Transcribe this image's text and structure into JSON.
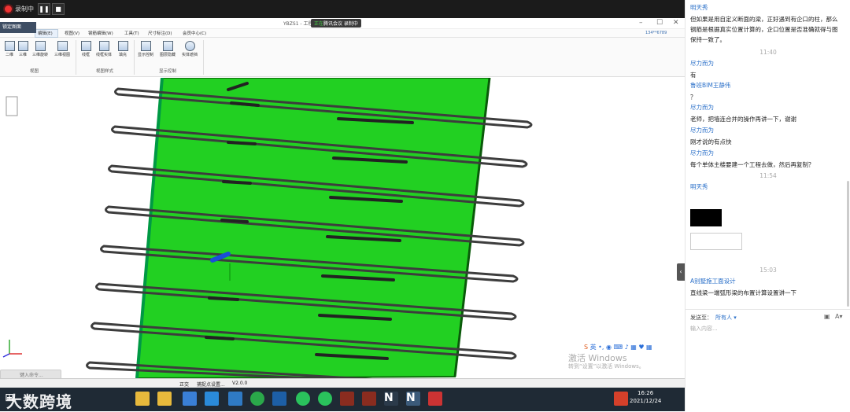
{
  "recording": {
    "label": "录制中"
  },
  "app": {
    "title": "YBZS1 - 工程",
    "notice": {
      "green": "正在",
      "text": "腾讯会议 录制中"
    },
    "lock_label": "锁定图面",
    "account": "134**6789",
    "menus": [
      "编辑(E)",
      "视图(V)",
      "钢筋编辑(W)",
      "工具(T)",
      "尺寸标注(D)",
      "会员中心(C)"
    ],
    "ribbon": {
      "buttons": [
        "二维",
        "三维",
        "三维旋转",
        "三维视图",
        "线框",
        "线框实体",
        "填充",
        "显示控制",
        "图层隐藏",
        "实体遮挡"
      ],
      "groups": [
        "视图",
        "视图样式",
        "显示控制"
      ]
    },
    "command_placeholder": "键入命令...",
    "status": {
      "mode": "正交",
      "capture": "捕捉点设置...",
      "version": "V2.0.0"
    },
    "watermark": {
      "line1": "激活 Windows",
      "line2": "转到“设置”以激活 Windows。"
    },
    "ime": {
      "label": "英"
    }
  },
  "taskbar": {
    "time": "16:26",
    "date": "2021/12/24"
  },
  "brand": "大数跨境",
  "chat": {
    "messages": [
      {
        "sender": "明天秀",
        "text": "但如果是用自定义断面的梁，正好遇到有企口的柱，那么钢筋是根据真实位置计算的，企口位置是否准确就得与图保持一致了。"
      },
      {
        "timestamp": "11:40"
      },
      {
        "sender": "尽力而为",
        "text": "有"
      },
      {
        "sender": "鲁班BIM王静伟",
        "text": "？"
      },
      {
        "sender": "尽力而为",
        "text": "老师，把墙连合并的操作再讲一下，谢谢"
      },
      {
        "sender": "尽力而为",
        "text": "刚才说的有点快"
      },
      {
        "sender": "尽力而为",
        "text": "每个单体主楼要建一个工程去做，然后再复制？"
      },
      {
        "timestamp": "11:54"
      },
      {
        "sender": "明天秀"
      },
      {
        "timestamp": "15:03"
      },
      {
        "sender": "A别墅施工面设计",
        "text": "直线梁一端弧形梁的布置计算设置讲一下"
      }
    ],
    "send_to_label": "发送至：",
    "send_target": "所有人 ▾",
    "input_placeholder": "输入内容..."
  },
  "colors": {
    "wall": "#22d022",
    "recbar": "#1b1b1b",
    "taskbar": "#1f2a35",
    "link": "#2b70c9"
  }
}
